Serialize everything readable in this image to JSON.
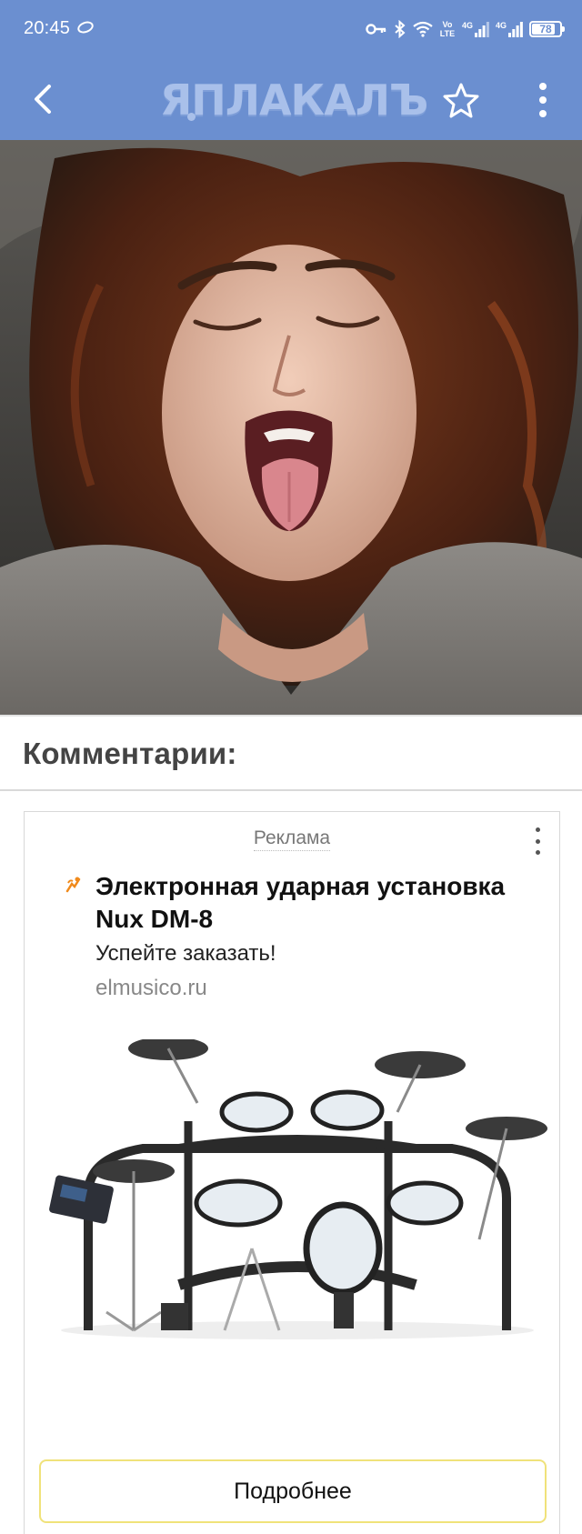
{
  "status_bar": {
    "time": "20:45",
    "volte_label": "Vo LTE",
    "sim1_label": "4G",
    "sim2_label": "4G",
    "battery_level": "78"
  },
  "app_bar": {
    "logo_text": "ЯПЛАКАЛЪ",
    "background_color": "#6b8fd0"
  },
  "post": {
    "image_icon": "photo-of-woman-lying-on-blanket"
  },
  "comments": {
    "title": "Комментарии:"
  },
  "ad": {
    "label": "Реклама",
    "favicon_icon": "orange-musician-icon",
    "title": "Электронная ударная установка Nux DM-8",
    "subtitle": "Успейте заказать!",
    "domain": "elmusico.ru",
    "image_icon": "electronic-drum-kit-photo",
    "cta_label": "Подробнее",
    "cta_border_color": "#f0e27a"
  }
}
